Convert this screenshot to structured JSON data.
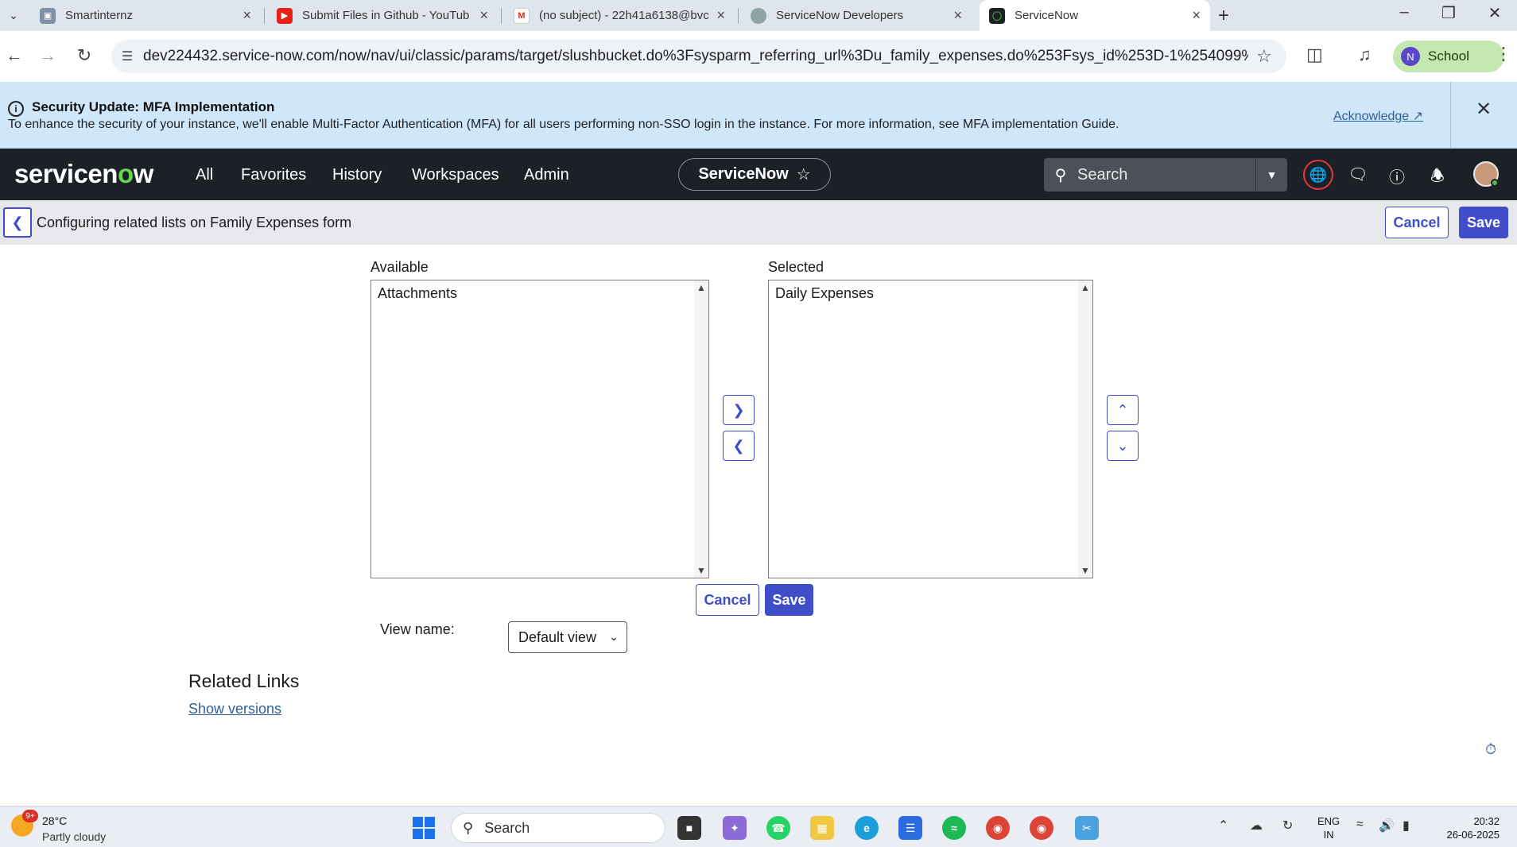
{
  "browser": {
    "tabs": [
      {
        "title": "Smartinternz",
        "icon": "smartinternz-icon"
      },
      {
        "title": "Submit Files in Github - YouTub",
        "icon": "youtube-icon"
      },
      {
        "title": "(no subject) - 22h41a6138@bvc",
        "icon": "gmail-icon"
      },
      {
        "title": "ServiceNow Developers",
        "icon": "servicenow-dev-icon"
      },
      {
        "title": "ServiceNow",
        "icon": "servicenow-icon"
      }
    ],
    "url": "dev224432.service-now.com/now/nav/ui/classic/params/target/slushbucket.do%3Fsysparm_referring_url%3Du_family_expenses.do%253Fsys_id%253D-1%254099%2540sysparm_...",
    "profile_initial": "N",
    "profile_label": "School"
  },
  "banner": {
    "title": "Security Update: MFA Implementation",
    "message": "To enhance the security of your instance, we'll enable Multi-Factor Authentication (MFA) for all users performing non-SSO login in the instance. For more information, see MFA implementation Guide.",
    "acknowledge": "Acknowledge ↗"
  },
  "header": {
    "logo": "servicenow",
    "nav": [
      "All",
      "Favorites",
      "History",
      "Workspaces",
      "Admin"
    ],
    "instance_label": "ServiceNow",
    "search_placeholder": "Search"
  },
  "context": {
    "title": "Configuring related lists on Family Expenses form",
    "cancel": "Cancel",
    "save": "Save"
  },
  "slushbucket": {
    "available_label": "Available",
    "available_items": [
      "Attachments"
    ],
    "selected_label": "Selected",
    "selected_items": [
      "Daily Expenses"
    ],
    "cancel": "Cancel",
    "save": "Save",
    "view_name_label": "View name:",
    "view_name_value": "Default view"
  },
  "related_links": {
    "title": "Related Links",
    "links": [
      "Show versions"
    ]
  },
  "taskbar": {
    "weather_badge": "9+",
    "temperature": "28°C",
    "weather": "Partly cloudy",
    "search": "Search",
    "lang_line1": "ENG",
    "lang_line2": "IN",
    "time": "20:32",
    "date": "26-06-2025"
  },
  "colors": {
    "accent": "#3f4ec8",
    "header_bg": "#1c2128",
    "banner_bg": "#cfe7f9",
    "logo_green": "#62d84e"
  }
}
